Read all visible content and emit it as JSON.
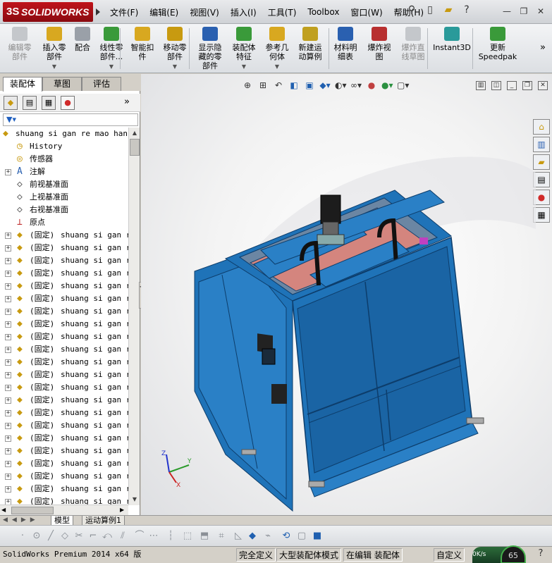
{
  "app": {
    "logo_text": "SOLIDWORKS",
    "logo_ds": "3S"
  },
  "menu": [
    "文件(F)",
    "编辑(E)",
    "视图(V)",
    "插入(I)",
    "工具(T)",
    "Toolbox",
    "窗口(W)",
    "帮助(H)"
  ],
  "toolbar": {
    "buttons": [
      {
        "label": "编辑零\n部件",
        "disabled": true,
        "icon": "edit-component-icon"
      },
      {
        "label": "插入零\n部件",
        "disabled": false,
        "dropdown": true,
        "icon": "insert-component-icon"
      },
      {
        "label": "配合",
        "disabled": false,
        "icon": "mate-icon"
      },
      {
        "label": "线性零\n部件...",
        "disabled": false,
        "dropdown": true,
        "icon": "linear-pattern-icon"
      },
      {
        "label": "智能扣\n件",
        "disabled": false,
        "icon": "smart-fastener-icon"
      },
      {
        "label": "移动零\n部件",
        "disabled": false,
        "dropdown": true,
        "icon": "move-component-icon"
      },
      {
        "label": "显示隐\n藏的零\n部件",
        "disabled": false,
        "icon": "show-hidden-icon"
      },
      {
        "label": "装配体\n特征",
        "disabled": false,
        "dropdown": true,
        "icon": "assembly-feature-icon"
      },
      {
        "label": "参考几\n何体",
        "disabled": false,
        "dropdown": true,
        "icon": "reference-geometry-icon"
      },
      {
        "label": "新建运\n动算例",
        "disabled": false,
        "icon": "new-motion-study-icon"
      },
      {
        "label": "材料明\n细表",
        "disabled": false,
        "icon": "bill-of-materials-icon"
      },
      {
        "label": "爆炸视\n图",
        "disabled": false,
        "icon": "exploded-view-icon"
      },
      {
        "label": "爆炸直\n线草图",
        "disabled": true,
        "icon": "explode-line-sketch-icon"
      },
      {
        "label": "Instant3D",
        "disabled": false,
        "icon": "instant3d-icon"
      },
      {
        "label": "更新\nSpeedpak",
        "disabled": false,
        "icon": "speedpak-icon"
      }
    ],
    "more": "»"
  },
  "panel": {
    "tabs": [
      "装配体",
      "草图",
      "评估"
    ],
    "expand": "»",
    "tree": [
      {
        "label": "shuang si gan re mao han j",
        "type": "root",
        "icon": "assembly-icon",
        "expandable": false
      },
      {
        "label": "History",
        "type": "item",
        "icon": "history-icon",
        "expandable": false
      },
      {
        "label": "传感器",
        "type": "item",
        "icon": "sensor-icon",
        "expandable": false
      },
      {
        "label": "注解",
        "type": "item",
        "icon": "annotation-icon",
        "expandable": true
      },
      {
        "label": "前视基准面",
        "type": "item",
        "icon": "plane-icon",
        "expandable": false
      },
      {
        "label": "上视基准面",
        "type": "item",
        "icon": "plane-icon",
        "expandable": false
      },
      {
        "label": "右视基准面",
        "type": "item",
        "icon": "plane-icon",
        "expandable": false
      },
      {
        "label": "原点",
        "type": "item",
        "icon": "origin-icon",
        "expandable": false
      }
    ],
    "component_prefix": "(固定)",
    "component_name": "shuang si gan re",
    "component_count": 22
  },
  "viewport": {
    "triad": {
      "x": "X",
      "y": "Y",
      "z": "Z"
    }
  },
  "bottom_tabs": [
    "模型",
    "运动算例1"
  ],
  "status": {
    "version": "SolidWorks Premium 2014 x64 版",
    "fully_defined": "完全定义",
    "large_assembly": "大型装配体模式",
    "editing": "在编辑 装配体",
    "custom": "自定义",
    "speed": "0K/s",
    "speed_big": "65"
  },
  "colors": {
    "machine_blue": "#1f73b8",
    "machine_dark": "#0f4a80",
    "accent_red": "#c0141b"
  }
}
